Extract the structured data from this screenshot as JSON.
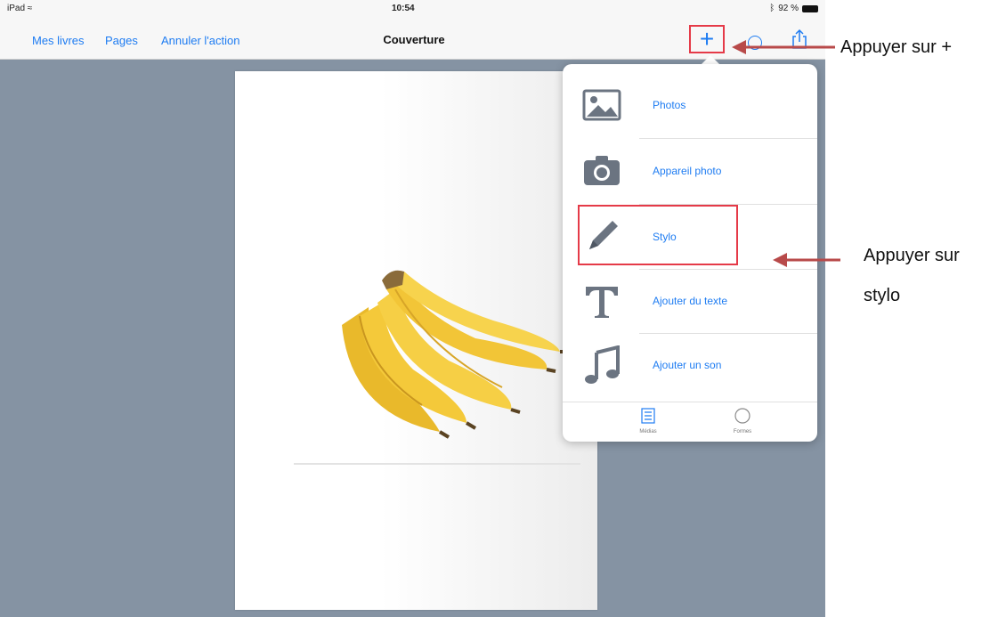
{
  "status_bar": {
    "device": "iPad",
    "time": "10:54",
    "battery": "92 %"
  },
  "nav": {
    "mes_livres": "Mes livres",
    "pages": "Pages",
    "annuler": "Annuler l'action",
    "title": "Couverture",
    "plus": "+"
  },
  "menu": {
    "items": [
      {
        "label": "Photos",
        "icon": "photos-icon"
      },
      {
        "label": "Appareil photo",
        "icon": "camera-icon"
      },
      {
        "label": "Stylo",
        "icon": "pen-icon"
      },
      {
        "label": "Ajouter du texte",
        "icon": "text-icon"
      },
      {
        "label": "Ajouter un son",
        "icon": "music-note-icon"
      }
    ],
    "tabs": [
      {
        "label": "Médias",
        "icon": "media-tab-icon"
      },
      {
        "label": "Formes",
        "icon": "shapes-tab-icon"
      }
    ]
  },
  "annotations": {
    "top": "Appuyer sur +",
    "stylo_line1": "Appuyer sur",
    "stylo_line2": "stylo"
  },
  "colors": {
    "accent": "#1e7cf2",
    "highlight": "#e53a48",
    "arrow": "#b84a4a",
    "background": "#8593a3"
  }
}
